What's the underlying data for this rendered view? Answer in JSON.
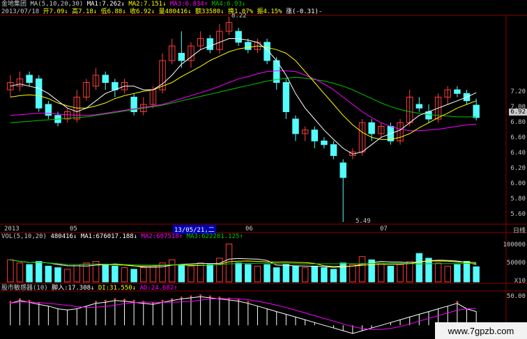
{
  "header": {
    "stock_name": "金地集团",
    "ma_label": "MA(5,10,20,30)",
    "ma1": "MA1:7.262↓",
    "ma2": "MA2:7.151↓",
    "ma3": "MA3:6.834↑",
    "ma4": "MA4:6.93↓",
    "date": "2013/07/18",
    "open": "开7.09↓",
    "high": "高7.18↓",
    "low": "低6.88↓",
    "close": "收6.92↓",
    "volume": "量480416↓",
    "amount": "额33580↓",
    "turnover": "换1.07%",
    "amplitude": "振4.15%",
    "change": "涨(-0.31)-"
  },
  "price_axis": {
    "ticks": [
      "7.20",
      "7.00",
      "6.80",
      "6.60",
      "6.40",
      "6.20",
      "6.00",
      "5.80",
      "5.60"
    ],
    "current_price": "6.92",
    "high_marker": "8.22",
    "low_marker": "5.49"
  },
  "time_axis": {
    "year": "2013",
    "months": [
      "05",
      "06",
      "07"
    ],
    "cursor_date": "13/05/21,二",
    "period": "日线"
  },
  "volume_panel": {
    "label": "VOL(5,10,20)",
    "value": "480416↓",
    "ma1": "MA1:676017.188↓",
    "ma2": "MA2:607518↑",
    "ma3": "MA3:622281.125↑",
    "ticks": [
      "100000",
      "50000",
      "X10"
    ]
  },
  "sentiment_panel": {
    "label": "股市敏感器(10)",
    "line1": "脚入:17.308↓",
    "line2": "DI:31.550↓",
    "line3": "AD:24.682↑",
    "tick": "50.00"
  },
  "watermark": "www.7gpzb.com",
  "colors": {
    "up": "#ff3c3c",
    "down": "#54fcfc",
    "ma1": "#ffffff",
    "ma2": "#ffff00",
    "ma3": "#ff00ff",
    "ma4": "#00c800",
    "grid": "#8b0000"
  },
  "chart_data": {
    "type": "candlestick",
    "price_ylim": [
      5.5,
      8.3
    ],
    "candles": [
      {
        "o": 7.3,
        "c": 7.4,
        "h": 7.5,
        "l": 7.2
      },
      {
        "o": 7.35,
        "c": 7.45,
        "h": 7.55,
        "l": 7.28
      },
      {
        "o": 7.5,
        "c": 7.4,
        "h": 7.55,
        "l": 7.35
      },
      {
        "o": 7.45,
        "c": 7.05,
        "h": 7.5,
        "l": 7.0
      },
      {
        "o": 7.1,
        "c": 6.95,
        "h": 7.15,
        "l": 6.9
      },
      {
        "o": 6.95,
        "c": 6.85,
        "h": 7.0,
        "l": 6.8
      },
      {
        "o": 6.9,
        "c": 7.0,
        "h": 7.05,
        "l": 6.85
      },
      {
        "o": 6.9,
        "c": 7.2,
        "h": 7.3,
        "l": 6.85
      },
      {
        "o": 7.2,
        "c": 7.4,
        "h": 7.45,
        "l": 7.15
      },
      {
        "o": 7.35,
        "c": 7.5,
        "h": 7.6,
        "l": 7.3
      },
      {
        "o": 7.5,
        "c": 7.4,
        "h": 7.55,
        "l": 7.3
      },
      {
        "o": 7.4,
        "c": 7.3,
        "h": 7.45,
        "l": 7.2
      },
      {
        "o": 7.3,
        "c": 7.4,
        "h": 7.45,
        "l": 7.25
      },
      {
        "o": 7.2,
        "c": 7.0,
        "h": 7.25,
        "l": 6.95
      },
      {
        "o": 7.0,
        "c": 7.1,
        "h": 7.2,
        "l": 6.95
      },
      {
        "o": 7.1,
        "c": 7.3,
        "h": 7.35,
        "l": 7.05
      },
      {
        "o": 7.3,
        "c": 7.7,
        "h": 7.8,
        "l": 7.25
      },
      {
        "o": 7.7,
        "c": 7.9,
        "h": 8.0,
        "l": 7.65
      },
      {
        "o": 7.8,
        "c": 7.7,
        "h": 8.1,
        "l": 7.6
      },
      {
        "o": 7.7,
        "c": 7.9,
        "h": 7.95,
        "l": 7.6
      },
      {
        "o": 7.9,
        "c": 8.0,
        "h": 8.1,
        "l": 7.85
      },
      {
        "o": 8.0,
        "c": 7.85,
        "h": 8.05,
        "l": 7.8
      },
      {
        "o": 7.85,
        "c": 8.1,
        "h": 8.2,
        "l": 7.8
      },
      {
        "o": 8.1,
        "c": 8.22,
        "h": 8.3,
        "l": 8.05
      },
      {
        "o": 8.1,
        "c": 7.95,
        "h": 8.15,
        "l": 7.9
      },
      {
        "o": 7.95,
        "c": 7.85,
        "h": 8.0,
        "l": 7.8
      },
      {
        "o": 7.85,
        "c": 7.95,
        "h": 8.0,
        "l": 7.8
      },
      {
        "o": 7.95,
        "c": 7.7,
        "h": 8.0,
        "l": 7.65
      },
      {
        "o": 7.7,
        "c": 7.4,
        "h": 7.75,
        "l": 7.3
      },
      {
        "o": 7.4,
        "c": 7.0,
        "h": 7.45,
        "l": 6.9
      },
      {
        "o": 6.9,
        "c": 6.7,
        "h": 6.95,
        "l": 6.6
      },
      {
        "o": 6.7,
        "c": 6.75,
        "h": 6.8,
        "l": 6.6
      },
      {
        "o": 6.75,
        "c": 6.6,
        "h": 6.8,
        "l": 6.5
      },
      {
        "o": 6.6,
        "c": 6.55,
        "h": 6.65,
        "l": 6.5
      },
      {
        "o": 6.55,
        "c": 6.4,
        "h": 6.6,
        "l": 6.35
      },
      {
        "o": 6.3,
        "c": 6.1,
        "h": 6.35,
        "l": 5.49
      },
      {
        "o": 6.4,
        "c": 6.45,
        "h": 6.5,
        "l": 6.35
      },
      {
        "o": 6.45,
        "c": 6.85,
        "h": 6.9,
        "l": 6.4
      },
      {
        "o": 6.85,
        "c": 6.7,
        "h": 6.9,
        "l": 6.6
      },
      {
        "o": 6.7,
        "c": 6.8,
        "h": 6.85,
        "l": 6.65
      },
      {
        "o": 6.8,
        "c": 6.6,
        "h": 6.85,
        "l": 6.55
      },
      {
        "o": 6.6,
        "c": 6.85,
        "h": 6.9,
        "l": 6.55
      },
      {
        "o": 6.85,
        "c": 7.2,
        "h": 7.3,
        "l": 6.8
      },
      {
        "o": 7.1,
        "c": 7.05,
        "h": 7.2,
        "l": 7.0
      },
      {
        "o": 7.0,
        "c": 6.9,
        "h": 7.1,
        "l": 6.85
      },
      {
        "o": 6.9,
        "c": 7.2,
        "h": 7.25,
        "l": 6.85
      },
      {
        "o": 7.2,
        "c": 7.3,
        "h": 7.35,
        "l": 7.1
      },
      {
        "o": 7.3,
        "c": 7.25,
        "h": 7.35,
        "l": 7.2
      },
      {
        "o": 7.25,
        "c": 7.15,
        "h": 7.3,
        "l": 7.1
      },
      {
        "o": 7.09,
        "c": 6.92,
        "h": 7.18,
        "l": 6.88
      }
    ],
    "ma1": [
      7.35,
      7.38,
      7.35,
      7.32,
      7.25,
      7.15,
      7.05,
      7.0,
      7.05,
      7.15,
      7.25,
      7.3,
      7.35,
      7.35,
      7.3,
      7.3,
      7.38,
      7.5,
      7.65,
      7.75,
      7.85,
      7.9,
      7.95,
      8.0,
      8.0,
      7.98,
      7.95,
      7.85,
      7.7,
      7.5,
      7.25,
      7.05,
      6.9,
      6.75,
      6.62,
      6.5,
      6.42,
      6.45,
      6.55,
      6.65,
      6.7,
      6.75,
      6.85,
      6.95,
      7.0,
      7.05,
      7.1,
      7.15,
      7.2,
      7.26
    ],
    "ma2": [
      7.2,
      7.22,
      7.23,
      7.22,
      7.18,
      7.12,
      7.08,
      7.05,
      7.05,
      7.08,
      7.12,
      7.18,
      7.22,
      7.25,
      7.28,
      7.3,
      7.35,
      7.4,
      7.48,
      7.55,
      7.62,
      7.7,
      7.76,
      7.82,
      7.86,
      7.88,
      7.9,
      7.88,
      7.85,
      7.8,
      7.7,
      7.55,
      7.4,
      7.25,
      7.1,
      6.95,
      6.82,
      6.72,
      6.65,
      6.62,
      6.62,
      6.65,
      6.7,
      6.78,
      6.85,
      6.92,
      6.98,
      7.05,
      7.1,
      7.15
    ],
    "ma3": [
      6.95,
      6.96,
      6.97,
      6.98,
      6.98,
      6.97,
      6.96,
      6.95,
      6.95,
      6.96,
      6.98,
      7.0,
      7.02,
      7.04,
      7.06,
      7.08,
      7.1,
      7.14,
      7.18,
      7.22,
      7.26,
      7.3,
      7.35,
      7.4,
      7.45,
      7.48,
      7.52,
      7.55,
      7.56,
      7.56,
      7.55,
      7.5,
      7.45,
      7.38,
      7.3,
      7.2,
      7.1,
      7.0,
      6.92,
      6.85,
      6.8,
      6.76,
      6.74,
      6.74,
      6.75,
      6.76,
      6.78,
      6.8,
      6.82,
      6.83
    ],
    "ma4": [
      6.85,
      6.86,
      6.87,
      6.88,
      6.89,
      6.9,
      6.91,
      6.92,
      6.93,
      6.95,
      6.97,
      6.99,
      7.01,
      7.03,
      7.05,
      7.07,
      7.09,
      7.12,
      7.15,
      7.18,
      7.21,
      7.24,
      7.27,
      7.3,
      7.33,
      7.36,
      7.39,
      7.42,
      7.44,
      7.46,
      7.47,
      7.46,
      7.44,
      7.42,
      7.39,
      7.35,
      7.3,
      7.24,
      7.18,
      7.12,
      7.07,
      7.03,
      7.0,
      6.98,
      6.96,
      6.95,
      6.94,
      6.93,
      6.93,
      6.93
    ],
    "volume": [
      70,
      60,
      55,
      65,
      50,
      45,
      40,
      55,
      60,
      65,
      55,
      50,
      45,
      40,
      45,
      50,
      60,
      70,
      55,
      50,
      60,
      55,
      75,
      120,
      60,
      55,
      50,
      55,
      45,
      55,
      50,
      45,
      50,
      45,
      40,
      60,
      55,
      80,
      70,
      60,
      50,
      55,
      65,
      90,
      75,
      60,
      50,
      55,
      65,
      48
    ],
    "volume_ylim": [
      0,
      130
    ],
    "sentiment": [
      40,
      45,
      42,
      38,
      35,
      30,
      28,
      30,
      35,
      40,
      42,
      45,
      44,
      42,
      40,
      38,
      42,
      45,
      48,
      50,
      52,
      50,
      48,
      46,
      44,
      40,
      35,
      30,
      25,
      20,
      15,
      10,
      5,
      0,
      -5,
      -10,
      -15,
      -10,
      -5,
      0,
      5,
      10,
      15,
      20,
      25,
      30,
      35,
      40,
      30,
      25
    ],
    "sentiment_ylim": [
      -20,
      60
    ]
  }
}
